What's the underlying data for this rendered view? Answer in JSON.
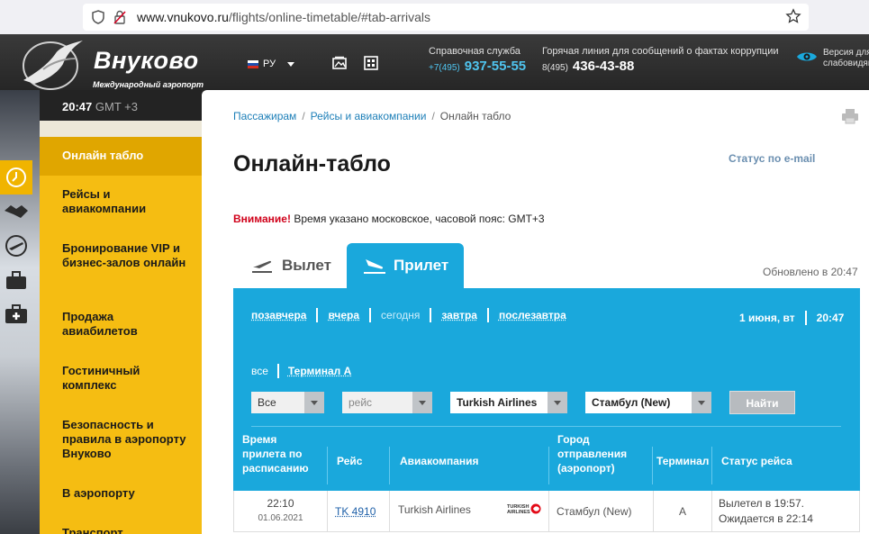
{
  "browser": {
    "url_domain": "www.vnukovo.ru",
    "url_path": "/flights/online-timetable/#tab-arrivals"
  },
  "header": {
    "logo_title": "Внуково",
    "logo_subtitle": "Международный аэропорт",
    "lang": "РУ",
    "help_label": "Справочная служба",
    "help_prefix": "+7(495)",
    "help_number": "937-55-55",
    "hotline_label": "Горячая линия для сообщений о фактах коррупции",
    "hotline_prefix": "8(495)",
    "hotline_number": "436-43-88",
    "vision_line1": "Версия для",
    "vision_line2": "слабовидящих"
  },
  "sidebar": {
    "time": "20:47",
    "tz": "GMT +3",
    "items": [
      {
        "label": "Онлайн табло"
      },
      {
        "label": "Рейсы и авиакомпании"
      },
      {
        "label": "Бронирование VIP и бизнес-залов онлайн"
      },
      {
        "label": "Продажа авиабилетов"
      },
      {
        "label": "Гостиничный комплекс"
      },
      {
        "label": "Безопасность и правила в аэропорту Внуково"
      },
      {
        "label": "В аэропорту"
      },
      {
        "label": "Транспорт"
      }
    ]
  },
  "breadcrumb": {
    "item1": "Пассажирам",
    "item2": "Рейсы и авиакомпании",
    "current": "Онлайн табло"
  },
  "page": {
    "title": "Онлайн-табло",
    "email_status": "Статус по e-mail",
    "notice_label": "Внимание!",
    "notice_text": " Время указано московское, часовой пояс: GMT+3",
    "tab_departures": "Вылет",
    "tab_arrivals": "Прилет",
    "updated": "Обновлено в 20:47"
  },
  "board": {
    "days": [
      "позавчера",
      "вчера",
      "сегодня",
      "завтра",
      "послезавтра"
    ],
    "date": "1 июня, вт",
    "time": "20:47",
    "terminal_all": "все",
    "terminal_a": "Терминал А",
    "filter_type": "Все",
    "filter_flight_placeholder": "рейс",
    "filter_airline": "Turkish Airlines",
    "filter_city": "Стамбул (New)",
    "find_button": "Найти",
    "columns": {
      "time": "Время прилета по расписанию",
      "flight": "Рейс",
      "airline": "Авиакомпания",
      "city": "Город отправления (аэропорт)",
      "terminal": "Терминал",
      "status": "Статус рейса"
    },
    "rows": [
      {
        "time": "22:10",
        "date": "01.06.2021",
        "flight": "TK 4910",
        "airline": "Turkish Airlines",
        "city": "Стамбул (New)",
        "terminal": "A",
        "status_line1": "Вылетел в 19:57.",
        "status_line2": "Ожидается в 22:14"
      }
    ]
  },
  "colors": {
    "accent_blue": "#1aa8dc",
    "sidebar_yellow": "#f5bd12",
    "warning_red": "#d0021b"
  }
}
